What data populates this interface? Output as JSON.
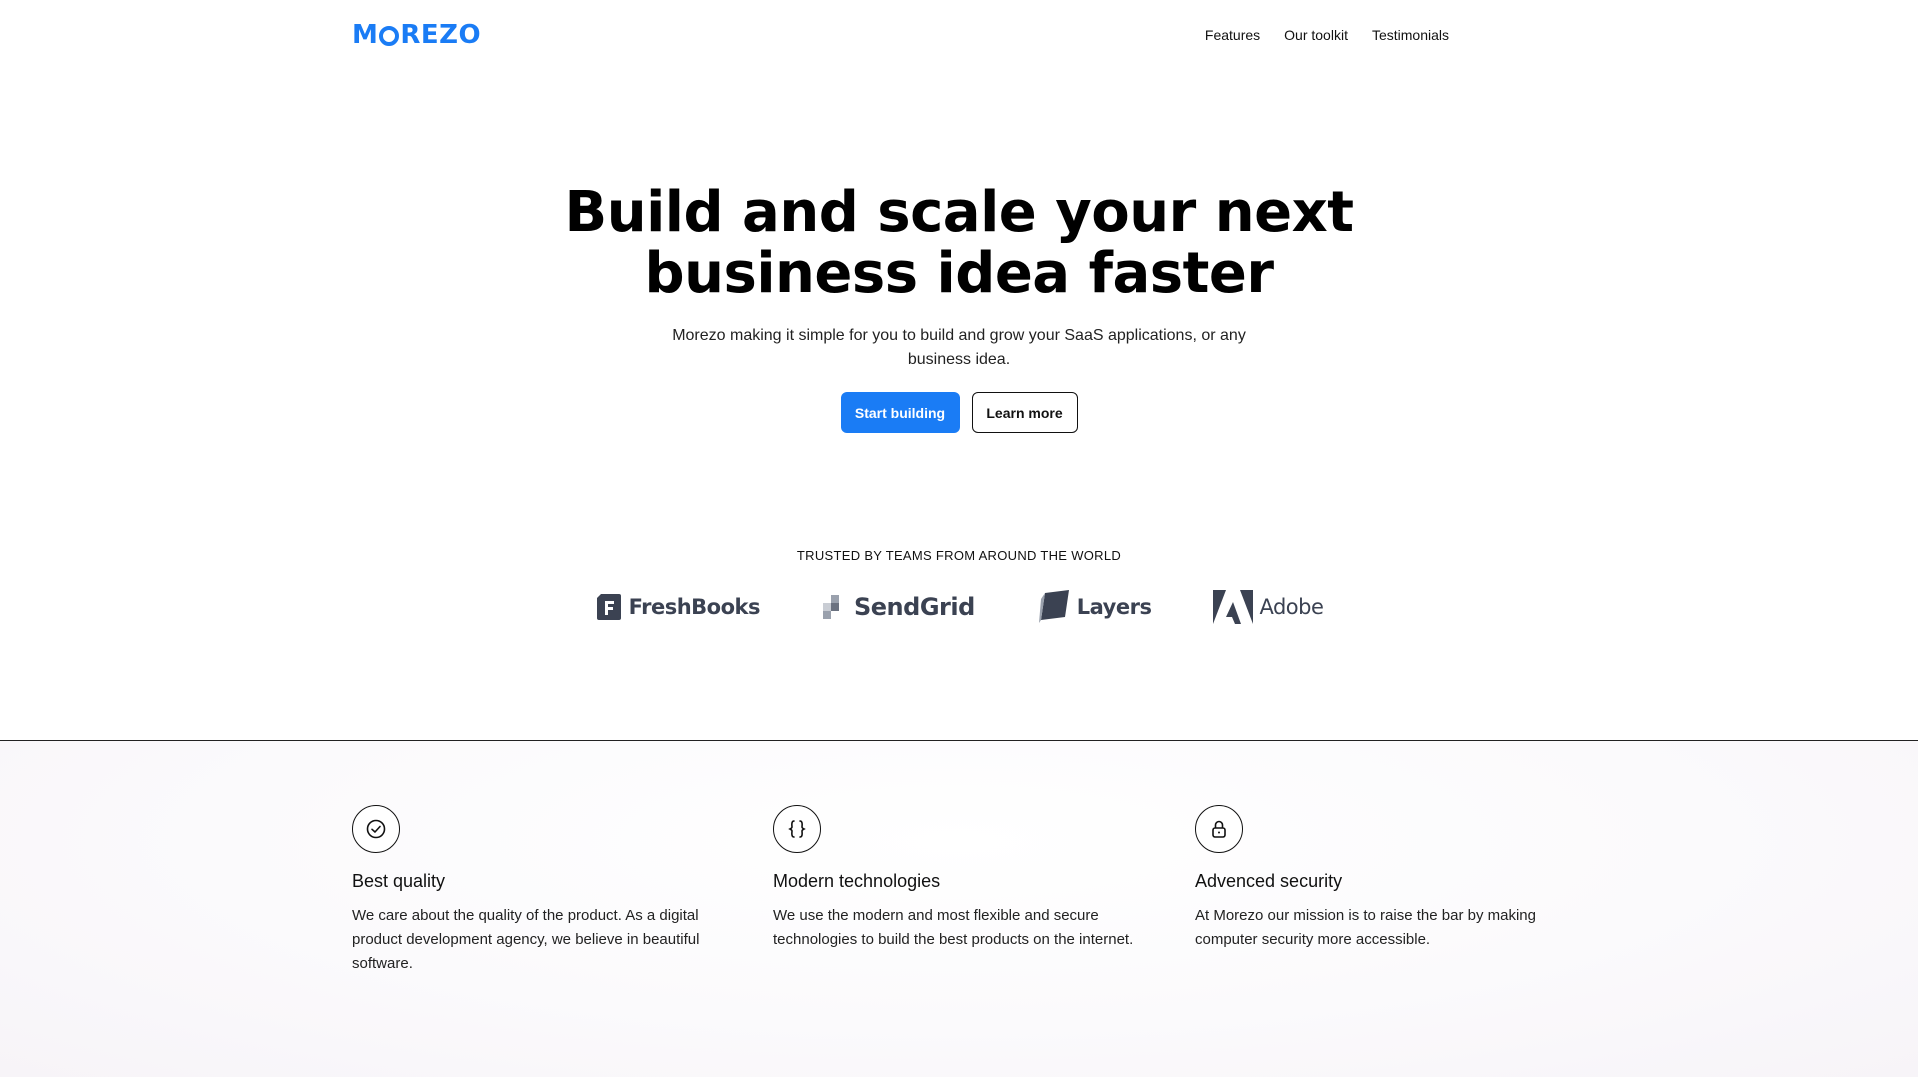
{
  "header": {
    "logo_text": "MOREZO",
    "nav": [
      "Features",
      "Our toolkit",
      "Testimonials"
    ]
  },
  "hero": {
    "title": "Build and scale your next business idea faster",
    "subtitle": "Morezo making it simple for you to build and grow your SaaS applications, or any business idea.",
    "primary_cta": "Start building",
    "secondary_cta": "Learn more"
  },
  "trusted": {
    "label": "TRUSTED BY TEAMS FROM AROUND THE WORLD",
    "brands": [
      "FreshBooks",
      "SendGrid",
      "Layers",
      "Adobe"
    ]
  },
  "features": [
    {
      "icon": "check-circle-icon",
      "title": "Best quality",
      "text": "We care about the quality of the product. As a digital product development agency, we believe in beautiful software."
    },
    {
      "icon": "code-braces-icon",
      "title": "Modern technologies",
      "text": "We use the modern and most flexible and secure technologies to build the best products on the internet."
    },
    {
      "icon": "lock-icon",
      "title": "Advenced security",
      "text": "At Morezo our mission is to raise the bar by making computer security more accessible."
    }
  ],
  "colors": {
    "brand": "#1a7cf5",
    "text": "#111111",
    "brand_logo_gray": "#3b4252"
  }
}
